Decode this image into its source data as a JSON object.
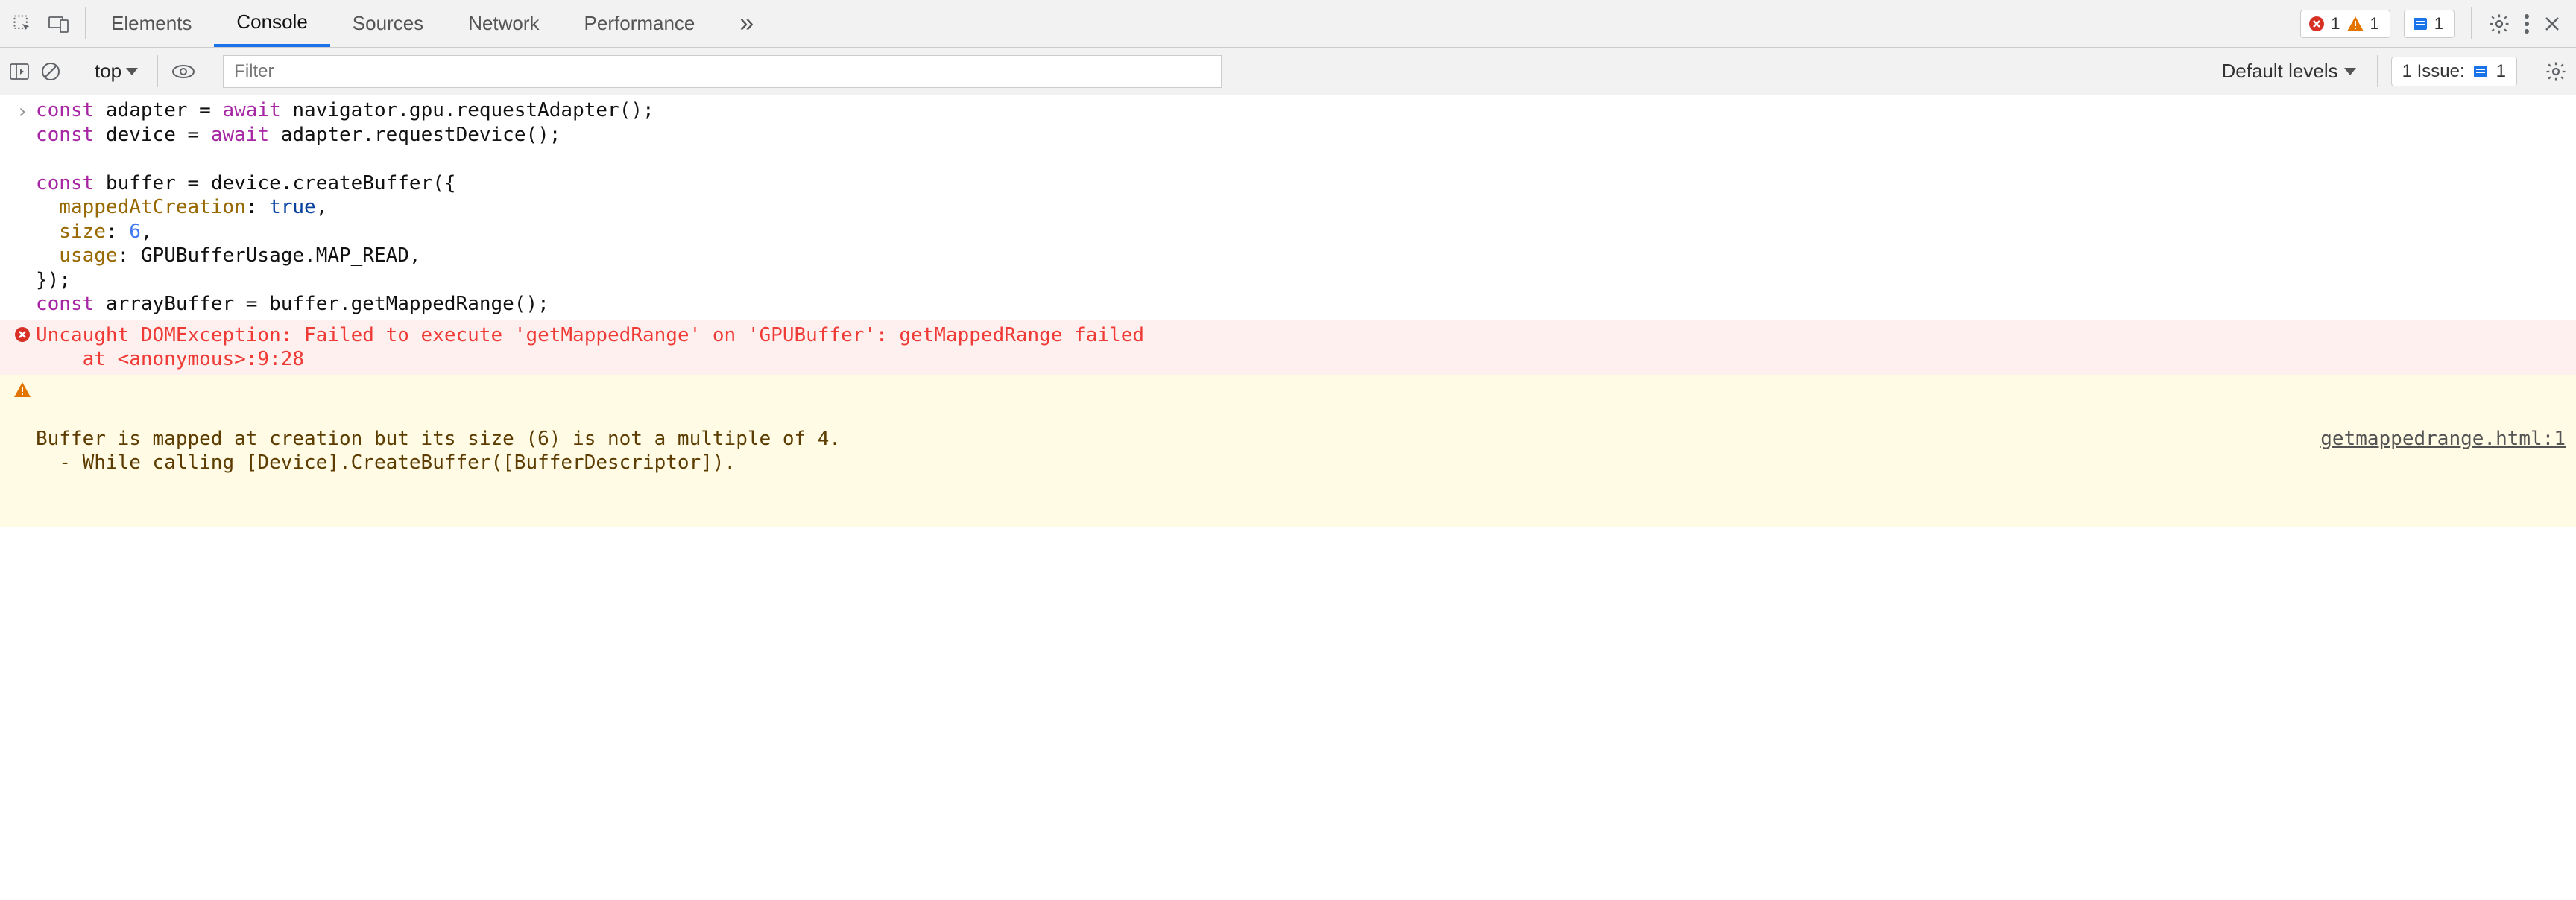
{
  "tabs": {
    "elements": "Elements",
    "console": "Console",
    "sources": "Sources",
    "network": "Network",
    "performance": "Performance"
  },
  "badges": {
    "error_count": "1",
    "warn_count": "1",
    "info_count": "1"
  },
  "subbar": {
    "context": "top",
    "filter_placeholder": "Filter",
    "levels": "Default levels",
    "issues_label": "1 Issue:",
    "issues_count": "1"
  },
  "code": {
    "l1a": "const",
    "l1b": " adapter = ",
    "l1c": "await",
    "l1d": " navigator.gpu.requestAdapter();",
    "l2a": "const",
    "l2b": " device = ",
    "l2c": "await",
    "l2d": " adapter.requestDevice();",
    "blank": "",
    "l3a": "const",
    "l3b": " buffer = device.createBuffer({",
    "l4a": "  mappedAtCreation",
    "l4b": ": ",
    "l4c": "true",
    "l4d": ",",
    "l5a": "  size",
    "l5b": ": ",
    "l5c": "6",
    "l5d": ",",
    "l6a": "  usage",
    "l6b": ": GPUBufferUsage.",
    "l6c": "MAP_READ",
    "l6d": ",",
    "l7": "});",
    "l8a": "const",
    "l8b": " arrayBuffer = buffer.getMappedRange();"
  },
  "error": {
    "line1": "Uncaught DOMException: Failed to execute 'getMappedRange' on 'GPUBuffer': getMappedRange failed",
    "line2": "    at <anonymous>:9:28"
  },
  "warning": {
    "msg": "Buffer is mapped at creation but its size (6) is not a multiple of 4.",
    "cont": "  - While calling [Device].CreateBuffer([BufferDescriptor]).",
    "source": "getmappedrange.html:1"
  }
}
